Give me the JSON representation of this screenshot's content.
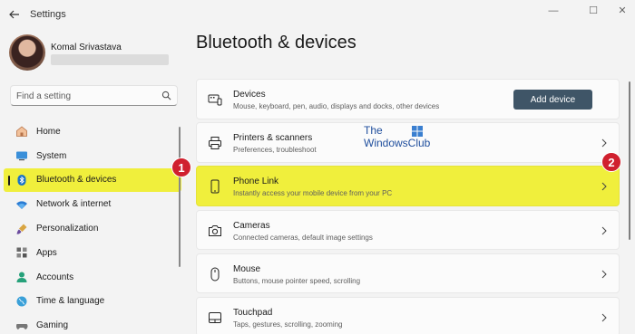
{
  "window": {
    "title": "Settings",
    "minimize": "—",
    "maximize": "☐",
    "close": "✕"
  },
  "profile": {
    "name": "Komal Srivastava",
    "email": ""
  },
  "search": {
    "placeholder": "Find a setting"
  },
  "nav": {
    "items": [
      {
        "label": "Home",
        "icon": "home-icon"
      },
      {
        "label": "System",
        "icon": "system-icon"
      },
      {
        "label": "Bluetooth & devices",
        "icon": "bluetooth-icon",
        "selected": true
      },
      {
        "label": "Network & internet",
        "icon": "wifi-icon"
      },
      {
        "label": "Personalization",
        "icon": "brush-icon"
      },
      {
        "label": "Apps",
        "icon": "apps-icon"
      },
      {
        "label": "Accounts",
        "icon": "accounts-icon"
      },
      {
        "label": "Time & language",
        "icon": "globe-icon"
      },
      {
        "label": "Gaming",
        "icon": "gaming-icon"
      }
    ]
  },
  "page": {
    "title": "Bluetooth & devices"
  },
  "cards": [
    {
      "title": "Devices",
      "subtitle": "Mouse, keyboard, pen, audio, displays and docks, other devices",
      "icon": "devices-icon",
      "button": "Add device"
    },
    {
      "title": "Printers & scanners",
      "subtitle": "Preferences, troubleshoot",
      "icon": "printer-icon"
    },
    {
      "title": "Phone Link",
      "subtitle": "Instantly access your mobile device from your PC",
      "icon": "phone-icon",
      "highlighted": true
    },
    {
      "title": "Cameras",
      "subtitle": "Connected cameras, default image settings",
      "icon": "camera-icon"
    },
    {
      "title": "Mouse",
      "subtitle": "Buttons, mouse pointer speed, scrolling",
      "icon": "mouse-icon"
    },
    {
      "title": "Touchpad",
      "subtitle": "Taps, gestures, scrolling, zooming",
      "icon": "touchpad-icon"
    }
  ],
  "annotations": {
    "badge1": "1",
    "badge2": "2"
  },
  "watermark": {
    "line1": "The",
    "line2": "WindowsClub"
  },
  "colors": {
    "highlight": "#f0ef3c",
    "badge": "#d0202e",
    "button": "#3f5567",
    "bluetooth": "#1a73c8"
  }
}
